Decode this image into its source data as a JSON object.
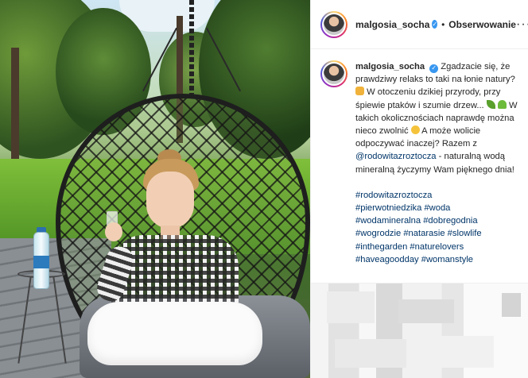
{
  "post": {
    "username": "malgosia_socha",
    "verified_symbol": "✓",
    "separator": "•",
    "follow_label": "Obserwowanie",
    "more_label": "···"
  },
  "caption": {
    "username": "malgosia_socha",
    "text_1": "Zgadzacie się, że prawdziwy relaks to taki na łonie natury?",
    "text_2": "W otoczeniu dzikiej przyrody, przy śpiewie ptaków i szumie drzew...",
    "text_3": "W takich okolicznościach naprawdę można nieco zwolnić",
    "text_4": "A może wolicie odpoczywać inaczej? Razem z",
    "mention": "@rodowitazroztocza",
    "text_5": "- naturalną wodą mineralną życzymy Wam pięknego dnia!"
  },
  "hashtags": [
    "#rodowitazroztocza",
    "#pierwotniedzika #woda",
    "#wodamineralna #dobregodnia",
    "#wogrodzie #natarasie #slowlife",
    "#inthegarden #naturelovers",
    "#haveagoodday #womanstyle"
  ],
  "colors": {
    "link": "#003569",
    "verified": "#3897f0",
    "text": "#262626"
  },
  "icons": [
    "verified-badge-icon",
    "alarm-clock-emoji-icon",
    "leaf-emoji-icon",
    "seedling-emoji-icon",
    "smile-emoji-icon",
    "more-options-icon"
  ]
}
